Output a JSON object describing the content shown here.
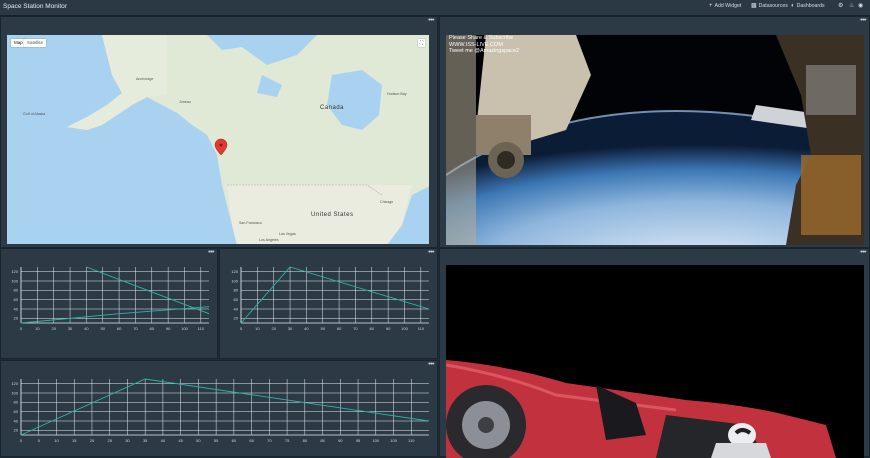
{
  "header": {
    "title": "Space Station Monitor",
    "add_widget": "Add Widget",
    "datasources": "Datasources",
    "dashboards": "Dashboards"
  },
  "widgets": {
    "menu_label": "•••",
    "map": {
      "map_button": "Map",
      "satellite_button": "Satellite",
      "labels": {
        "canada": "Canada",
        "united_states": "United States",
        "anchorage": "Anchorage",
        "juneau": "Juneau",
        "hudson_bay": "Hudson Bay",
        "san_francisco": "San Francisco",
        "los_angeles": "Los Angeles",
        "las_vegas": "Las Vegas",
        "chicago": "Chicago",
        "gulf_of_alaska": "Gulf of Alaska"
      }
    },
    "video1": {
      "overlay_line1": "Please Share & Subscribe",
      "overlay_line2": "WWW.ISS-LIVE.COM",
      "overlay_line3": "Tweet me @Amazingspace2"
    }
  },
  "chart_data": [
    {
      "type": "line",
      "x_ticks": [
        0,
        10,
        20,
        30,
        40,
        50,
        60,
        70,
        80,
        90,
        100,
        110
      ],
      "y_ticks": [
        20,
        40,
        60,
        80,
        100,
        120
      ],
      "xlim": [
        0,
        115
      ],
      "ylim": [
        10,
        130
      ],
      "series": [
        {
          "color": "#2cb5a8",
          "x": [
            0,
            60,
            115
          ],
          "y": [
            10,
            30,
            45
          ]
        },
        {
          "color": "#2cb5a8",
          "x": [
            40,
            115
          ],
          "y": [
            130,
            30
          ]
        }
      ]
    },
    {
      "type": "line",
      "x_ticks": [
        0,
        10,
        20,
        30,
        40,
        50,
        60,
        70,
        80,
        90,
        100,
        110
      ],
      "y_ticks": [
        20,
        40,
        60,
        80,
        100,
        120
      ],
      "xlim": [
        0,
        115
      ],
      "ylim": [
        10,
        130
      ],
      "series": [
        {
          "color": "#2cb5a8",
          "x": [
            0,
            30,
            115
          ],
          "y": [
            10,
            130,
            40
          ]
        }
      ]
    },
    {
      "type": "line",
      "x_ticks": [
        0,
        5,
        10,
        15,
        20,
        25,
        30,
        35,
        40,
        45,
        50,
        55,
        60,
        65,
        70,
        75,
        80,
        85,
        90,
        95,
        100,
        105,
        110
      ],
      "y_ticks": [
        20,
        40,
        60,
        80,
        100,
        120
      ],
      "xlim": [
        0,
        115
      ],
      "ylim": [
        10,
        130
      ],
      "series": [
        {
          "color": "#2cb5a8",
          "x": [
            0,
            35,
            115
          ],
          "y": [
            10,
            130,
            40
          ]
        }
      ]
    }
  ]
}
